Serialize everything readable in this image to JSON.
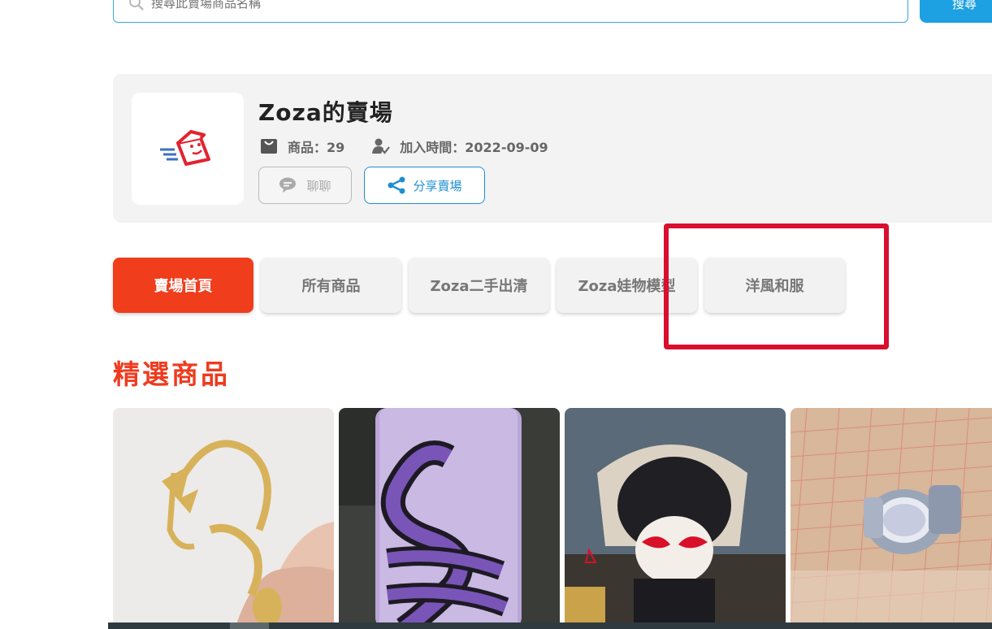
{
  "search": {
    "placeholder": "搜尋此賣場商品名稱",
    "button_label": "搜尋"
  },
  "store": {
    "name": "Zoza的賣場",
    "products_label": "商品：29",
    "joined_label": "加入時間：2022-09-09",
    "chat_label": "聊聊",
    "share_label": "分享賣場"
  },
  "tabs": [
    {
      "label": "賣場首頁",
      "active": true
    },
    {
      "label": "所有商品",
      "active": false
    },
    {
      "label": "Zoza二手出清",
      "active": false
    },
    {
      "label": "Zoza娃物模型",
      "active": false
    },
    {
      "label": "洋風和服",
      "active": false
    }
  ],
  "featured": {
    "title": "精選商品"
  },
  "colors": {
    "accent": "#f03d1c",
    "link_blue": "#1f8fd1",
    "highlight": "#d80f2e"
  }
}
